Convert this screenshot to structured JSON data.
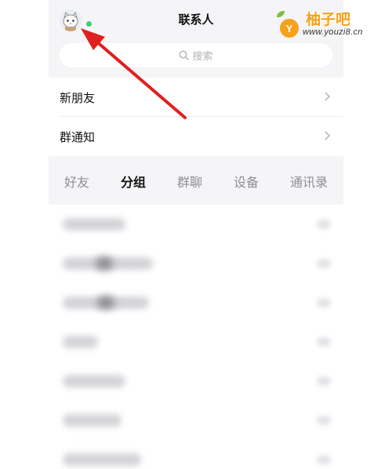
{
  "header": {
    "title": "联系人"
  },
  "search": {
    "placeholder": "搜索"
  },
  "rows": [
    {
      "label": "新朋友"
    },
    {
      "label": "群通知"
    }
  ],
  "tabs": [
    {
      "label": "好友",
      "active": false
    },
    {
      "label": "分组",
      "active": true
    },
    {
      "label": "群聊",
      "active": false
    },
    {
      "label": "设备",
      "active": false
    },
    {
      "label": "通讯录",
      "active": false
    }
  ],
  "colors": {
    "online": "#3fd07a",
    "annotation_arrow": "#e02020",
    "watermark_orange": "#f4a11b"
  },
  "watermark": {
    "title": "柚子吧",
    "url": "www.youzi8.cn",
    "badge": "Y"
  },
  "icons": [
    "avatar",
    "search-icon",
    "chevron-right-icon",
    "annotation-arrow"
  ]
}
